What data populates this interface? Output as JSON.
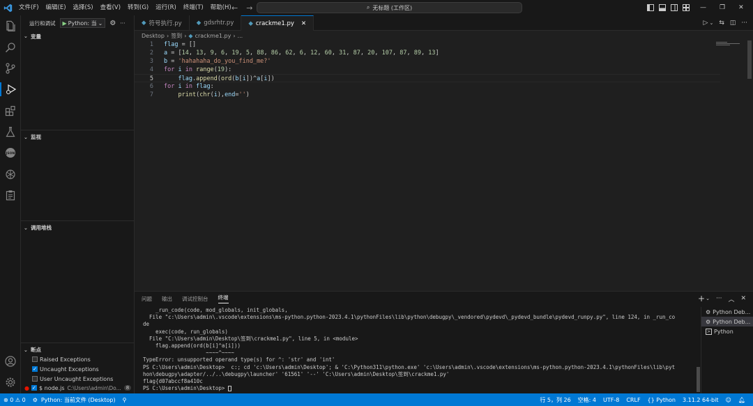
{
  "menu": [
    "文件(F)",
    "编辑(E)",
    "选择(S)",
    "查看(V)",
    "转到(G)",
    "运行(R)",
    "终端(T)",
    "帮助(H)"
  ],
  "command_center": "无标题 (工作区)",
  "sidebar": {
    "header": "运行和调试",
    "run_config": "Python: 当",
    "sections": {
      "variables": "变量",
      "watch": "监视",
      "callstack": "调用堆栈",
      "breakpoints": "断点"
    },
    "breakpoints": [
      {
        "label": "Raised Exceptions",
        "checked": false
      },
      {
        "label": "Uncaught Exceptions",
        "checked": true
      },
      {
        "label": "User Uncaught Exceptions",
        "checked": false
      }
    ],
    "bp_file": {
      "name": "$ node.js",
      "path": "C:\\Users\\admin\\Do...",
      "count": "8"
    }
  },
  "tabs": [
    {
      "label": "符号执行.py",
      "active": false
    },
    {
      "label": "gdsrhtr.py",
      "active": false
    },
    {
      "label": "crackme1.py",
      "active": true
    }
  ],
  "breadcrumb": [
    "Desktop",
    "签到",
    "crackme1.py",
    "..."
  ],
  "code": [
    {
      "n": "1",
      "html": "<span class='v'>flag</span><span class='p'> = []</span>"
    },
    {
      "n": "2",
      "html": "<span class='v'>a</span><span class='p'> = [</span><span class='n'>14</span><span class='p'>, </span><span class='n'>13</span><span class='p'>, </span><span class='n'>9</span><span class='p'>, </span><span class='n'>6</span><span class='p'>, </span><span class='n'>19</span><span class='p'>, </span><span class='n'>5</span><span class='p'>, </span><span class='n'>88</span><span class='p'>, </span><span class='n'>86</span><span class='p'>, </span><span class='n'>62</span><span class='p'>, </span><span class='n'>6</span><span class='p'>, </span><span class='n'>12</span><span class='p'>, </span><span class='n'>60</span><span class='p'>, </span><span class='n'>31</span><span class='p'>, </span><span class='n'>87</span><span class='p'>, </span><span class='n'>20</span><span class='p'>, </span><span class='n'>107</span><span class='p'>, </span><span class='n'>87</span><span class='p'>, </span><span class='n'>89</span><span class='p'>, </span><span class='n'>13</span><span class='p'>]</span>"
    },
    {
      "n": "3",
      "html": "<span class='v'>b</span><span class='p'> = </span><span class='s'>'hahahaha_do_you_find_me?'</span>"
    },
    {
      "n": "4",
      "html": "<span class='k'>for</span><span class='v'> i </span><span class='k'>in</span><span class='f'> range</span><span class='p'>(</span><span class='n'>19</span><span class='p'>):</span>"
    },
    {
      "n": "5",
      "html": "<span class='p'>    </span><span class='v'>flag</span><span class='p'>.</span><span class='f'>append</span><span class='p'>(</span><span class='f'>ord</span><span class='p'>(</span><span class='v'>b</span><span class='p'>[</span><span class='v'>i</span><span class='p'>])^</span><span class='v'>a</span><span class='p'>[</span><span class='v'>i</span><span class='p'>])</span>"
    },
    {
      "n": "6",
      "html": "<span class='k'>for</span><span class='v'> i </span><span class='k'>in</span><span class='v'> flag</span><span class='p'>:</span>"
    },
    {
      "n": "7",
      "html": "<span class='p'>    </span><span class='f'>print</span><span class='p'>(</span><span class='f'>chr</span><span class='p'>(</span><span class='v'>i</span><span class='p'>),</span><span class='v'>end</span><span class='p'>=</span><span class='s'>''</span><span class='p'>)</span>"
    }
  ],
  "panel_tabs": [
    "问题",
    "输出",
    "调试控制台",
    "终端"
  ],
  "terminal_lines": [
    "    _run_code(code, mod_globals, init_globals,",
    "  File \"c:\\Users\\admin\\.vscode\\extensions\\ms-python.python-2023.4.1\\pythonFiles\\lib\\python\\debugpy\\_vendored\\pydevd\\_pydevd_bundle\\pydevd_runpy.py\", line 124, in _run_co",
    "de",
    "    exec(code, run_globals)",
    "  File \"C:\\Users\\admin\\Desktop\\签到\\crackme1.py\", line 5, in <module>",
    "    flag.append(ord(b[i]^a[i]))",
    "                    ~~~~^~~~~",
    "TypeError: unsupported operand type(s) for ^: 'str' and 'int'",
    "PS C:\\Users\\admin\\Desktop>  c:; cd 'c:\\Users\\admin\\Desktop'; & 'C:\\Python311\\python.exe' 'c:\\Users\\admin\\.vscode\\extensions\\ms-python.python-2023.4.1\\pythonFiles\\lib\\pyt",
    "hon\\debugpy\\adapter/../..\\debugpy\\launcher' '61561' '--' 'C:\\Users\\admin\\Desktop\\签到\\crackme1.py'",
    "flag{d07abccf8a410c",
    "PS C:\\Users\\admin\\Desktop> "
  ],
  "terminal_list": [
    "Python Deb...",
    "Python Deb...",
    "Python"
  ],
  "status_left": [
    "⊗ 0 ⚠ 0",
    "Python: 当前文件 (Desktop)"
  ],
  "status_right": [
    "行 5，列 26",
    "空格: 4",
    "UTF-8",
    "CRLF",
    "{} Python",
    "3.11.2 64-bit"
  ]
}
